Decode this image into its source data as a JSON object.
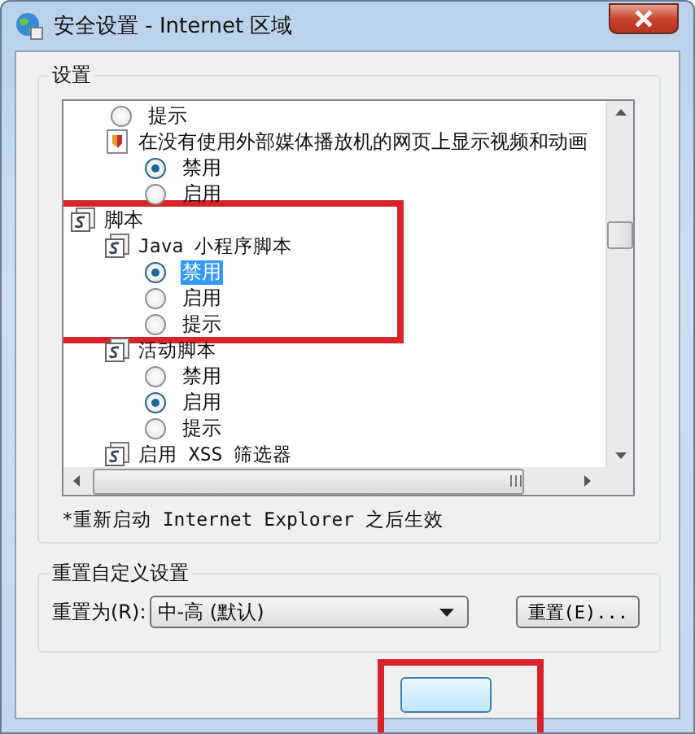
{
  "window": {
    "title": "安全设置 - Internet 区域"
  },
  "settings": {
    "legend": "设置",
    "tree": [
      {
        "kind": "category",
        "children": [
          {
            "kind": "radio",
            "label": "提示",
            "checked": false,
            "focused": false,
            "marked": false
          },
          {
            "kind": "media-setting",
            "label": "在没有使用外部媒体播放机的网页上显示视频和动画",
            "marked": false,
            "children": [
              {
                "kind": "radio",
                "label": "禁用",
                "checked": true,
                "focused": false,
                "marked": false
              },
              {
                "kind": "radio",
                "label": "启用",
                "checked": false,
                "focused": false,
                "marked": false
              }
            ]
          }
        ]
      },
      {
        "kind": "category",
        "label": "脚本",
        "marked": true,
        "children": [
          {
            "kind": "setting",
            "label": "Java 小程序脚本",
            "marked": true,
            "children": [
              {
                "kind": "radio",
                "label": "禁用",
                "checked": true,
                "focused": true,
                "marked": true
              },
              {
                "kind": "radio",
                "label": "启用",
                "checked": false,
                "focused": false,
                "marked": true
              },
              {
                "kind": "radio",
                "label": "提示",
                "checked": false,
                "focused": false,
                "marked": true
              }
            ]
          },
          {
            "kind": "setting",
            "label": "活动脚本",
            "marked": false,
            "children": [
              {
                "kind": "radio",
                "label": "禁用",
                "checked": false,
                "focused": false,
                "marked": false
              },
              {
                "kind": "radio",
                "label": "启用",
                "checked": true,
                "focused": false,
                "marked": false
              },
              {
                "kind": "radio",
                "label": "提示",
                "checked": false,
                "focused": false,
                "marked": false
              }
            ]
          },
          {
            "kind": "setting",
            "label": "启用 XSS 筛选器",
            "marked": false
          }
        ]
      }
    ],
    "note": "*重新启动 Internet Explorer 之后生效"
  },
  "reset": {
    "legend": "重置自定义设置",
    "label": "重置为(R):",
    "value": "中-高 (默认)",
    "button": "重置(E)..."
  },
  "footer_button": {
    "kind": "ok",
    "marked": true
  }
}
